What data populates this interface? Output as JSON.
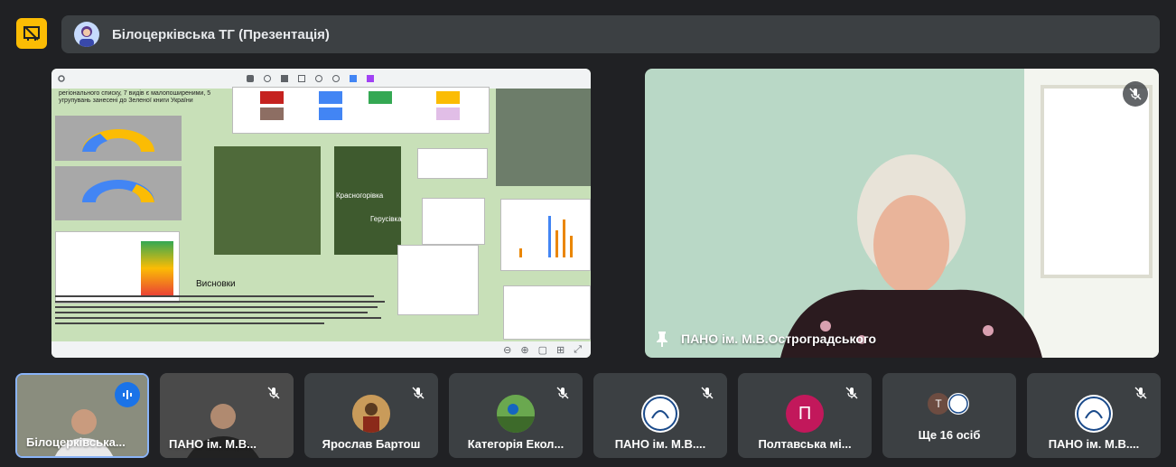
{
  "meeting": {
    "title": "Білоцерківська ТГ (Презентація)"
  },
  "presentation": {
    "slide_heading": "Висновки",
    "intro_text": "регіонального списку, 7 видів є малопоширеними, 5 угрупувань занесені до Зеленої книги України",
    "map_label_1": "Красногорівка",
    "map_label_2": "Герусівка"
  },
  "speaker": {
    "name": "ПАНО ім. М.В.Остроградського"
  },
  "participants": [
    {
      "name": "Білоцерківська...",
      "type": "video",
      "speaking": true
    },
    {
      "name": "ПАНО ім. М.В...",
      "type": "video",
      "muted": true
    },
    {
      "name": "Ярослав Бартош",
      "type": "photo",
      "muted": true
    },
    {
      "name": "Категорія Екол...",
      "type": "photo",
      "muted": true
    },
    {
      "name": "ПАНО ім. М.В....",
      "type": "logo",
      "muted": true
    },
    {
      "name": "Полтавська мі...",
      "type": "letter",
      "letter": "П",
      "color": "#c2185b",
      "muted": true
    },
    {
      "name": "Ще 16 осіб",
      "type": "more",
      "letter": "Т"
    },
    {
      "name": "ПАНО ім. М.В....",
      "type": "logo",
      "muted": true
    }
  ],
  "colors": {
    "background": "#202124",
    "tile": "#3c4043",
    "accent_yellow": "#fbbc04",
    "speaking_blue": "#1a73e8"
  }
}
